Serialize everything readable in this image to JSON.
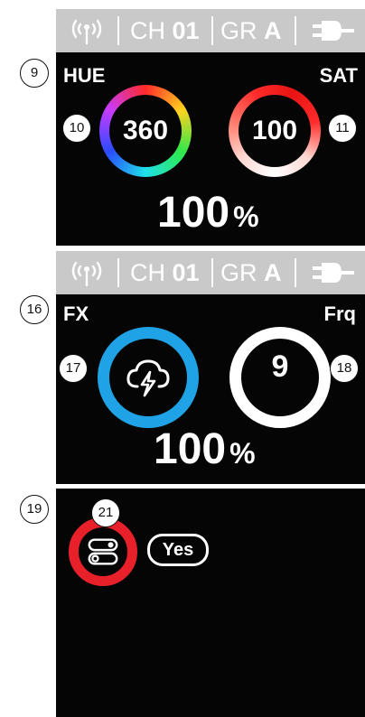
{
  "status_bar": {
    "ch_label": "CH",
    "ch_value": "01",
    "gr_label": "GR",
    "gr_value": "A",
    "icons": [
      "wireless-antenna-icon",
      "power-plug-icon"
    ]
  },
  "panel_hue_sat": {
    "hue_label": "HUE",
    "sat_label": "SAT",
    "hue_value": "360",
    "sat_value": "100",
    "intensity_value": "100",
    "intensity_unit": "%"
  },
  "panel_fx": {
    "fx_label": "FX",
    "frq_label": "Frq",
    "fx_icon": "storm-cloud-lightning-icon",
    "frq_value": "9",
    "intensity_value": "100",
    "intensity_unit": "%",
    "fx_ring_color": "#1fa3e6"
  },
  "panel_toggle": {
    "toggle_icon": "toggle-switches-icon",
    "yes_label": "Yes",
    "ring_color": "#e8202a"
  },
  "callouts": {
    "c9": "9",
    "c10": "10",
    "c11": "11",
    "c16": "16",
    "c17": "17",
    "c18": "18",
    "c19": "19",
    "c21": "21"
  }
}
